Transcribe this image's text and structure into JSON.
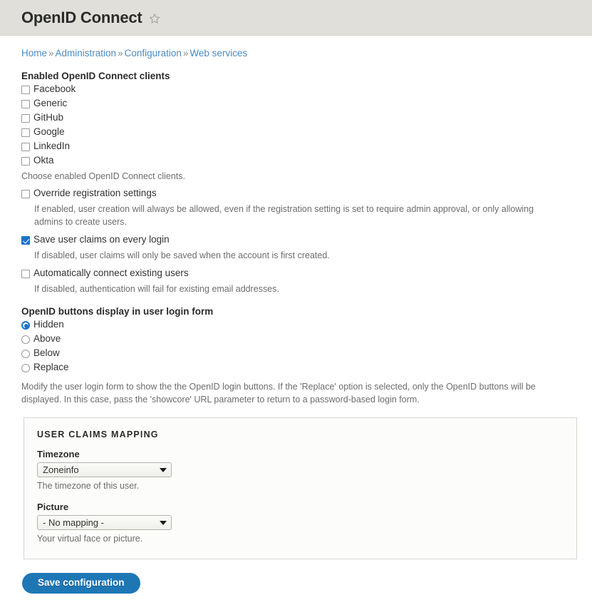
{
  "header": {
    "title": "OpenID Connect",
    "star_icon": "star-outline-icon"
  },
  "breadcrumb": {
    "separator": "»",
    "items": [
      {
        "label": "Home"
      },
      {
        "label": "Administration"
      },
      {
        "label": "Configuration"
      },
      {
        "label": "Web services"
      }
    ]
  },
  "clients": {
    "legend": "Enabled OpenID Connect clients",
    "description": "Choose enabled OpenID Connect clients.",
    "items": [
      {
        "label": "Facebook",
        "checked": false
      },
      {
        "label": "Generic",
        "checked": false
      },
      {
        "label": "GitHub",
        "checked": false
      },
      {
        "label": "Google",
        "checked": false
      },
      {
        "label": "LinkedIn",
        "checked": false
      },
      {
        "label": "Okta",
        "checked": false
      }
    ]
  },
  "settings": [
    {
      "label": "Override registration settings",
      "checked": false,
      "description": "If enabled, user creation will always be allowed, even if the registration setting is set to require admin approval, or only allowing admins to create users."
    },
    {
      "label": "Save user claims on every login",
      "checked": true,
      "description": "If disabled, user claims will only be saved when the account is first created."
    },
    {
      "label": "Automatically connect existing users",
      "checked": false,
      "description": "If disabled, authentication will fail for existing email addresses."
    }
  ],
  "buttons_display": {
    "legend": "OpenID buttons display in user login form",
    "options": [
      {
        "label": "Hidden",
        "selected": true
      },
      {
        "label": "Above",
        "selected": false
      },
      {
        "label": "Below",
        "selected": false
      },
      {
        "label": "Replace",
        "selected": false
      }
    ],
    "description": "Modify the user login form to show the the OpenID login buttons. If the 'Replace' option is selected, only the OpenID buttons will be displayed. In this case, pass the 'showcore' URL parameter to return to a password-based login form."
  },
  "claims_mapping": {
    "legend": "USER CLAIMS MAPPING",
    "fields": [
      {
        "label": "Timezone",
        "value": "Zoneinfo",
        "description": "The timezone of this user.",
        "caret_icon": "chevron-down-icon"
      },
      {
        "label": "Picture",
        "value": "- No mapping -",
        "description": "Your virtual face or picture.",
        "caret_icon": "chevron-down-icon"
      }
    ]
  },
  "actions": {
    "save_label": "Save configuration"
  },
  "colors": {
    "header_bg": "#e0dfd9",
    "link": "#4a8bc2",
    "accent": "#1a73c8",
    "button": "#1e77b5",
    "muted_text": "#6d6d6d",
    "fieldset_bg": "#fcfcfa",
    "fieldset_border": "#d6d6d0"
  }
}
